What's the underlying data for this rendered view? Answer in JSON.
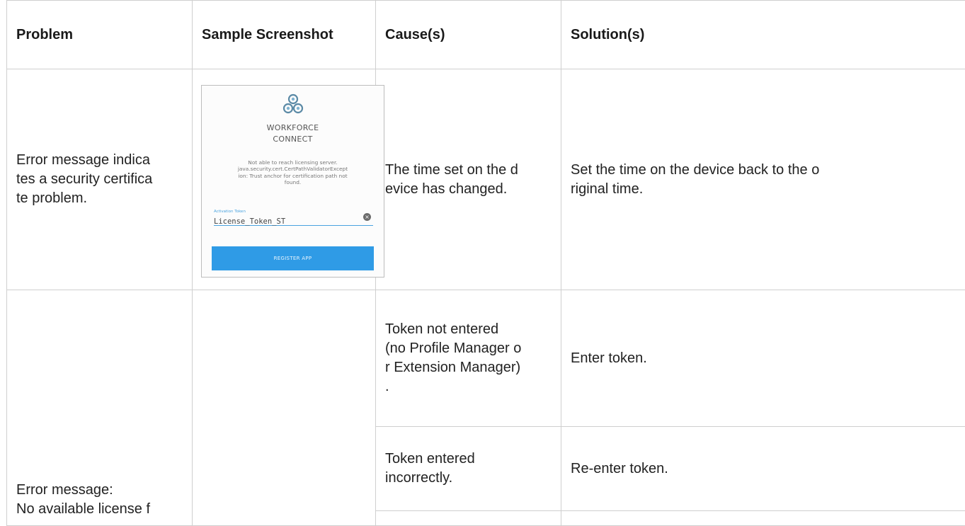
{
  "headers": {
    "problem": "Problem",
    "screenshot": "Sample Screenshot",
    "cause": "Cause(s)",
    "solution": "Solution(s)"
  },
  "rows": [
    {
      "problem": "Error message indica\ntes a security certifica\nte problem.",
      "cause": "The time set on the d\nevice has changed.",
      "solution": "Set the time on the device back to the o\nriginal time.",
      "screenshot": {
        "brand": "WORKFORCE\nCONNECT",
        "message": "Not able to reach licensing server.\njava.security.cert.CertPathValidatorExcept\nion: Trust anchor for certification path not\nfound.",
        "field_label": "Activation Token",
        "field_value": "License_Token_ST",
        "button_label": "REGISTER APP",
        "clear_icon": "×",
        "accent_color": "#2f9be6"
      }
    },
    {
      "problem": "Error message:\nNo available license f",
      "causes": [
        {
          "cause": "Token not entered\n(no Profile Manager o\nr Extension Manager)\n.",
          "solution": "Enter token."
        },
        {
          "cause": "Token entered\nincorrectly.",
          "solution": "Re-enter token."
        },
        {
          "cause": "",
          "solution": ""
        }
      ]
    }
  ]
}
